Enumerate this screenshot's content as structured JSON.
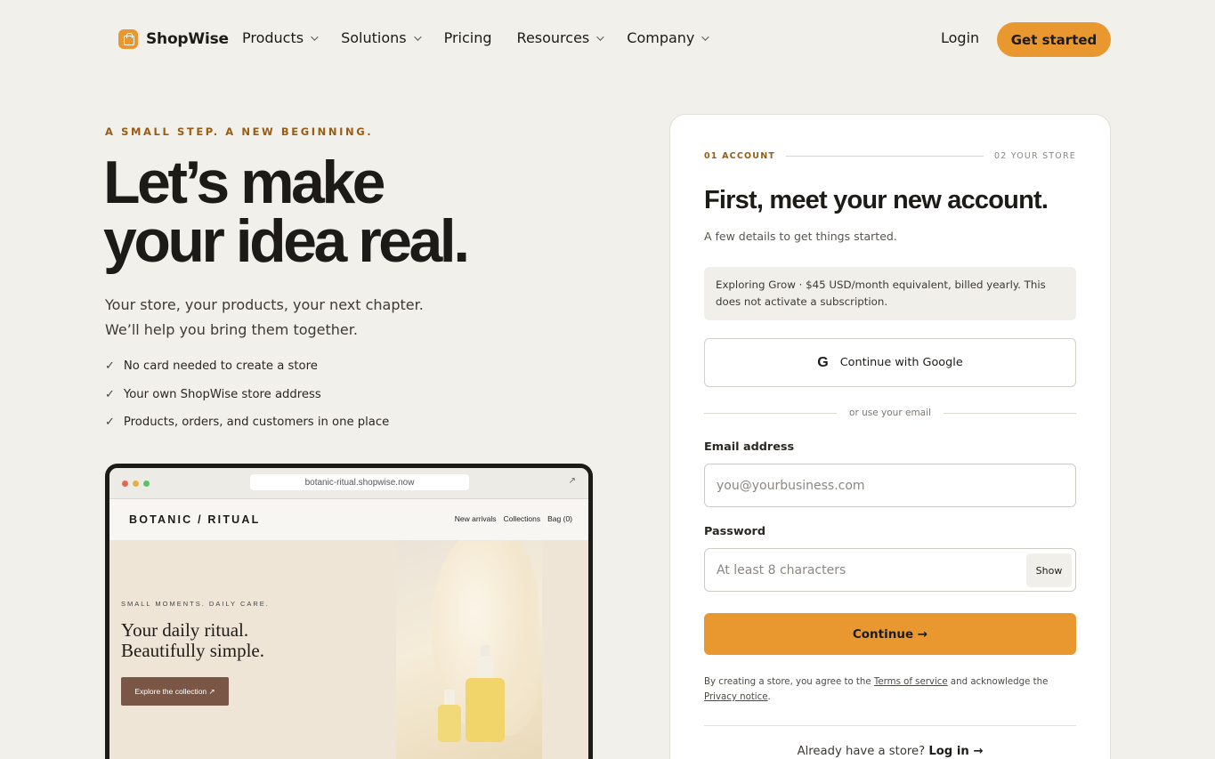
{
  "brand": {
    "name": "ShopWise",
    "logo_icon": "shopping-bag-icon",
    "accent": "#e8982f"
  },
  "nav": {
    "items": [
      {
        "label": "Products",
        "has_menu": true
      },
      {
        "label": "Solutions",
        "has_menu": true
      },
      {
        "label": "Pricing",
        "has_menu": false
      },
      {
        "label": "Resources",
        "has_menu": true
      },
      {
        "label": "Company",
        "has_menu": true
      }
    ],
    "login": "Login",
    "cta": "Get started"
  },
  "hero": {
    "eyebrow": "A SMALL STEP. A NEW BEGINNING.",
    "title_line1": "Let’s make",
    "title_line2": "your idea real.",
    "sub_line1": "Your store, your products, your next chapter.",
    "sub_line2": "We’ll help you bring them together.",
    "checks": [
      "No card needed to create a store",
      "Your own ShopWise store address",
      "Products, orders, and customers in one place"
    ]
  },
  "mockup": {
    "url": "botanic-ritual.shopwise.now",
    "brand": "BOTANIC / RITUAL",
    "links": [
      "New arrivals",
      "Collections",
      "Bag (0)"
    ],
    "kicker": "SMALL MOMENTS. DAILY CARE.",
    "title_line1": "Your daily ritual.",
    "title_line2": "Beautifully simple.",
    "button": "Explore the collection ↗"
  },
  "form": {
    "step1": "01 ACCOUNT",
    "step2": "02 YOUR STORE",
    "title": "First, meet your new account.",
    "subtitle": "A few details to get things started.",
    "notice": "Exploring Grow · $45 USD/month equivalent, billed yearly. This does not activate a subscription.",
    "google_label": "Continue with Google",
    "divider": "or use your email",
    "email_label": "Email address",
    "email_placeholder": "you@yourbusiness.com",
    "email_value": "",
    "password_label": "Password",
    "password_placeholder": "At least 8 characters",
    "password_value": "",
    "show_label": "Show",
    "continue_label": "Continue →",
    "legal_prefix": "By creating a store, you agree to the ",
    "terms_link": "Terms of service",
    "legal_middle": " and acknowledge the ",
    "privacy_link": "Privacy notice",
    "legal_suffix": ".",
    "already_text": "Already have a store? ",
    "login_link": "Log in →"
  }
}
